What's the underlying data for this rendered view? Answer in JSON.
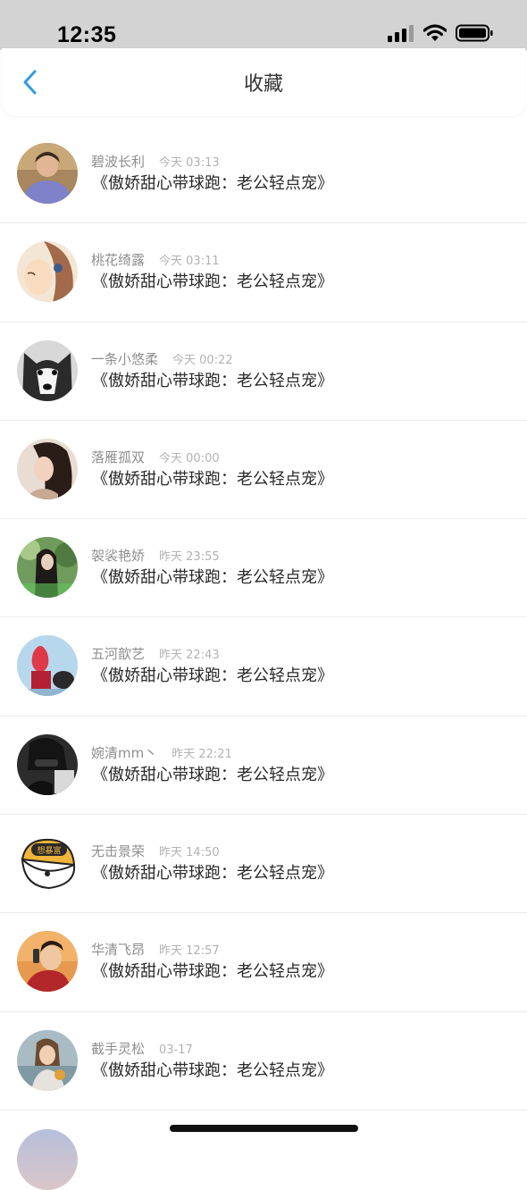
{
  "status_bar": {
    "time": "12:35",
    "icons": [
      "signal-icon",
      "wifi-icon",
      "battery-icon"
    ]
  },
  "navbar": {
    "title": "收藏",
    "back_icon": "chevron-left-icon",
    "accent_color": "#2f9be2"
  },
  "items": [
    {
      "name": "碧波长利",
      "time": "今天 03:13",
      "title": "《傲娇甜心带球跑：老公轻点宠》"
    },
    {
      "name": "桃花绮露",
      "time": "今天 03:11",
      "title": "《傲娇甜心带球跑：老公轻点宠》"
    },
    {
      "name": "一条小悠柔",
      "time": "今天 00:22",
      "title": "《傲娇甜心带球跑：老公轻点宠》"
    },
    {
      "name": "落雁孤双",
      "time": "今天 00:00",
      "title": "《傲娇甜心带球跑：老公轻点宠》"
    },
    {
      "name": "袈裟艳娇",
      "time": "昨天 23:55",
      "title": "《傲娇甜心带球跑：老公轻点宠》"
    },
    {
      "name": "五河歆艺",
      "time": "昨天 22:43",
      "title": "《傲娇甜心带球跑：老公轻点宠》"
    },
    {
      "name": "婉清mm丶",
      "time": "昨天 22:21",
      "title": "《傲娇甜心带球跑：老公轻点宠》"
    },
    {
      "name": "无击景荣",
      "time": "昨天 14:50",
      "title": "《傲娇甜心带球跑：老公轻点宠》"
    },
    {
      "name": "华清飞昂",
      "time": "昨天 12:57",
      "title": "《傲娇甜心带球跑：老公轻点宠》"
    },
    {
      "name": "截手灵松",
      "time": "03-17",
      "title": "《傲娇甜心带球跑：老公轻点宠》"
    }
  ],
  "avatar_text_7": "想暴富"
}
